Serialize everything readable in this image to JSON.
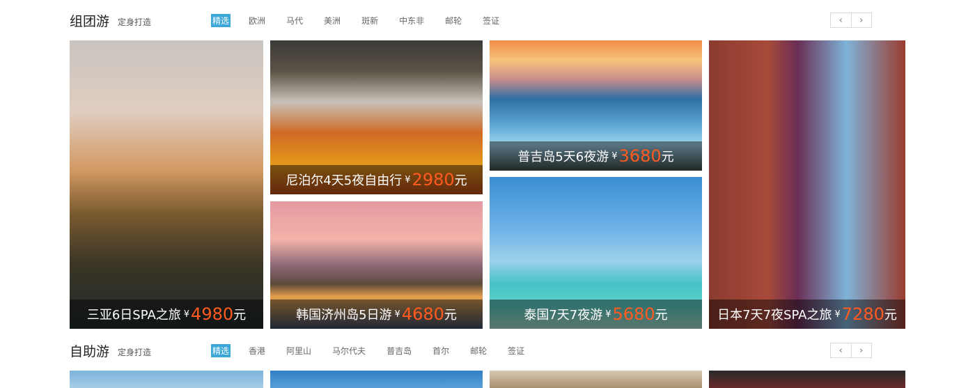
{
  "sections": [
    {
      "title": "组团游",
      "subtitle": "定身打造",
      "tabs": [
        "精选",
        "欧洲",
        "马代",
        "美洲",
        "斑新",
        "中东非",
        "邮轮",
        "签证"
      ],
      "active_tab": "精选",
      "cards": [
        {
          "name": "三亚6日SPA之旅",
          "price": "4980",
          "unit": "元",
          "yen": "¥"
        },
        {
          "name": "尼泊尔4天5夜自由行",
          "price": "2980",
          "unit": "元",
          "yen": "¥"
        },
        {
          "name": "韩国济州岛5日游",
          "price": "4680",
          "unit": "元",
          "yen": "¥"
        },
        {
          "name": "普吉岛5天6夜游",
          "price": "3680",
          "unit": "元",
          "yen": "¥"
        },
        {
          "name": "泰国7天7夜游",
          "price": "5680",
          "unit": "元",
          "yen": "¥"
        },
        {
          "name": "日本7天7夜SPA之旅",
          "price": "7280",
          "unit": "元",
          "yen": "¥"
        }
      ]
    },
    {
      "title": "自助游",
      "subtitle": "定身打造",
      "tabs": [
        "精选",
        "香港",
        "阿里山",
        "马尔代夫",
        "普吉岛",
        "首尔",
        "邮轮",
        "签证"
      ],
      "active_tab": "精选"
    }
  ],
  "pager": {
    "prev_icon": "‹",
    "next_icon": "›"
  }
}
